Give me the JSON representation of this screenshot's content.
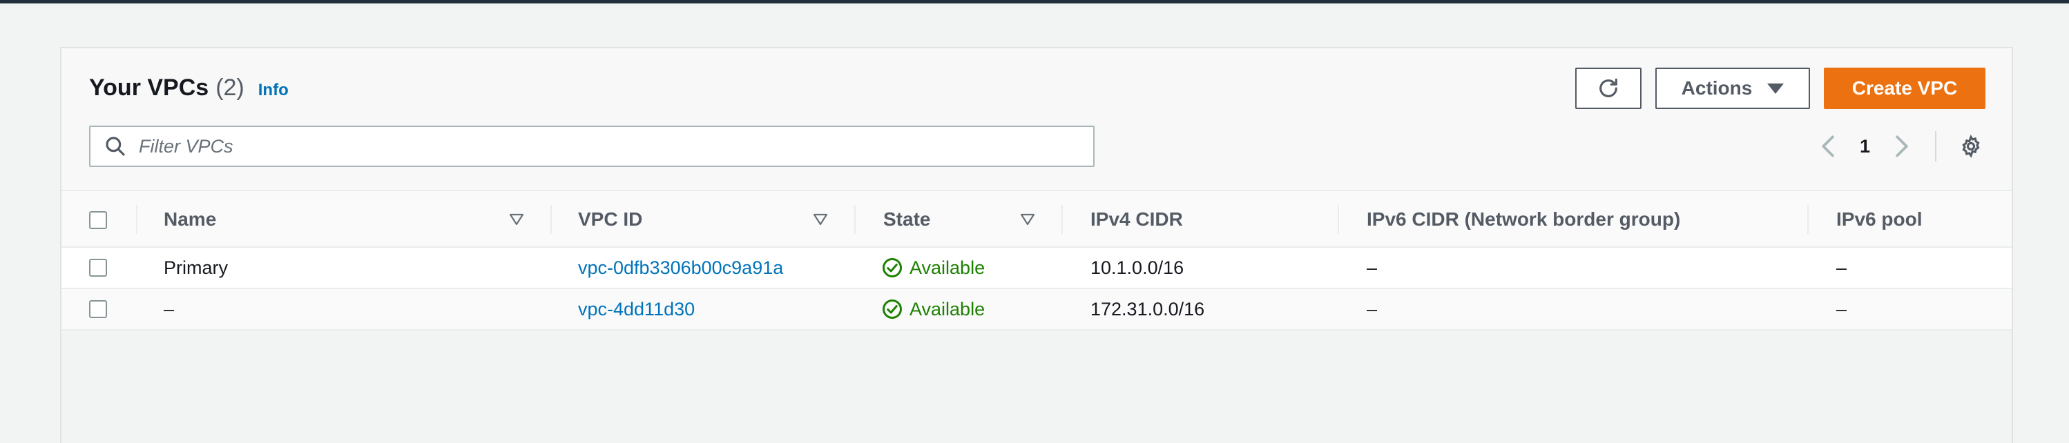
{
  "header": {
    "title": "Your VPCs",
    "count": "(2)",
    "info_link": "Info"
  },
  "toolbar": {
    "refresh_icon": "refresh-icon",
    "actions_label": "Actions",
    "create_label": "Create VPC"
  },
  "search": {
    "placeholder": "Filter VPCs",
    "value": ""
  },
  "pagination": {
    "current_page": "1"
  },
  "table": {
    "columns": [
      "Name",
      "VPC ID",
      "State",
      "IPv4 CIDR",
      "IPv6 CIDR (Network border group)",
      "IPv6 pool"
    ],
    "rows": [
      {
        "name": "Primary",
        "vpc_id": "vpc-0dfb3306b00c9a91a",
        "state": "Available",
        "ipv4_cidr": "10.1.0.0/16",
        "ipv6_cidr": "–",
        "ipv6_pool": "–"
      },
      {
        "name": "–",
        "vpc_id": "vpc-4dd11d30",
        "state": "Available",
        "ipv4_cidr": "172.31.0.0/16",
        "ipv6_cidr": "–",
        "ipv6_pool": "–"
      }
    ]
  },
  "colors": {
    "primary_button": "#ec7211",
    "link": "#0073bb",
    "status_ok": "#1d8102",
    "top_bar": "#232f3e"
  }
}
